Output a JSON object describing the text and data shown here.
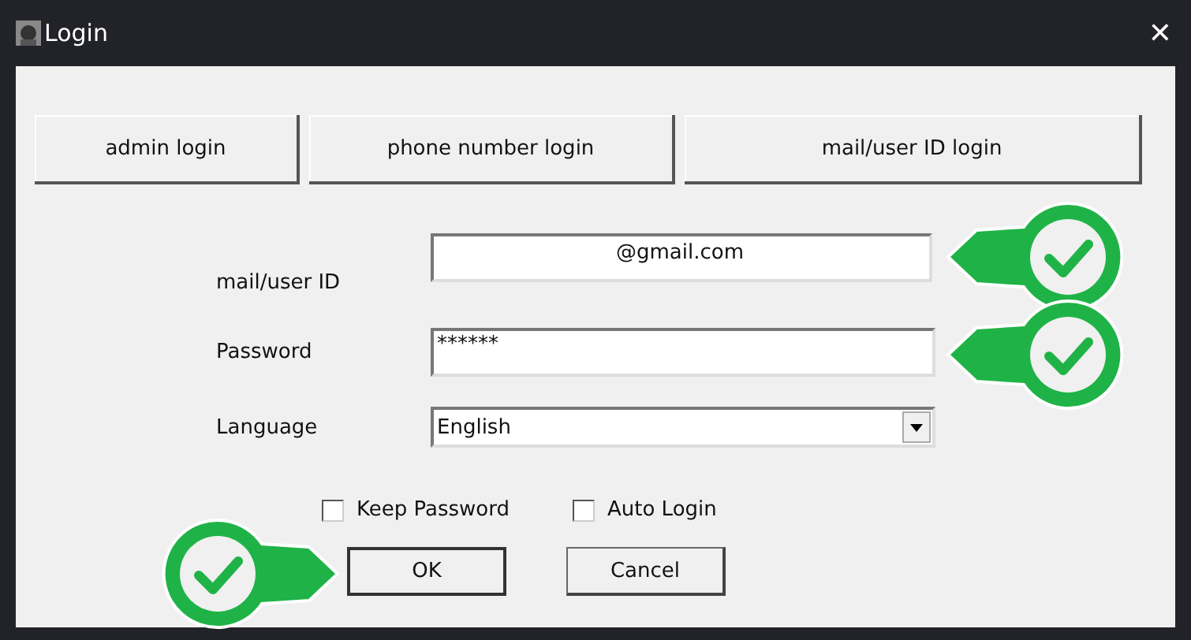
{
  "window": {
    "title": "Login",
    "close": "✕"
  },
  "login_modes": [
    {
      "label": "admin login"
    },
    {
      "label": "phone number login"
    },
    {
      "label": "mail/user ID login"
    }
  ],
  "fields": [
    {
      "label": "mail/user ID",
      "kind": "text",
      "value": "@gmail.com",
      "badge": true
    },
    {
      "label": "Password",
      "kind": "password",
      "value": "******",
      "badge": true
    },
    {
      "label": "Language",
      "kind": "select",
      "value": "English",
      "badge": false
    }
  ],
  "options": [
    {
      "label": "Keep Password",
      "checked": false
    },
    {
      "label": "Auto Login",
      "checked": false
    }
  ],
  "buttons": [
    {
      "label": "OK",
      "badge": true
    },
    {
      "label": "Cancel",
      "badge": false
    }
  ]
}
